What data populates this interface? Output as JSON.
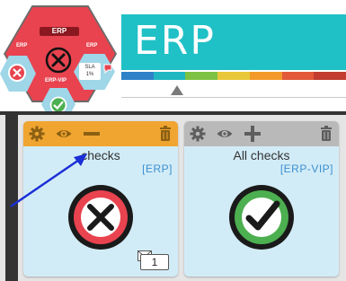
{
  "header": {
    "title": "ERP",
    "color_strip": [
      "#2f82c7",
      "#1fb7c2",
      "#7dc242",
      "#e9c73a",
      "#f39a2b",
      "#e25a3a",
      "#c23d2f"
    ]
  },
  "hex_cluster": {
    "main_label": "ERP",
    "left_label": "ERP",
    "right_label": "ERP",
    "bottom_label": "ERP-VIP",
    "sla_label": "SLA",
    "sla_value": "1%",
    "status": "error",
    "colors": {
      "error": "#e8434f",
      "ok": "#4caf50",
      "neutral": "#9fd6e8"
    }
  },
  "cards": [
    {
      "title": "checks",
      "subtitle": "[ERP]",
      "status": "error",
      "toolbar_color": "#f0a531",
      "counter": "1",
      "tools": [
        "gear-icon",
        "eye-icon",
        "minus-icon",
        "trash-icon"
      ]
    },
    {
      "title": "All checks",
      "subtitle": "[ERP-VIP]",
      "status": "ok",
      "toolbar_color": "#b9b9b9",
      "tools": [
        "gear-icon",
        "eye-icon",
        "plus-icon",
        "trash-icon"
      ]
    }
  ],
  "annotation": {
    "icon": "arrow-icon",
    "color": "#1a2fd6"
  }
}
